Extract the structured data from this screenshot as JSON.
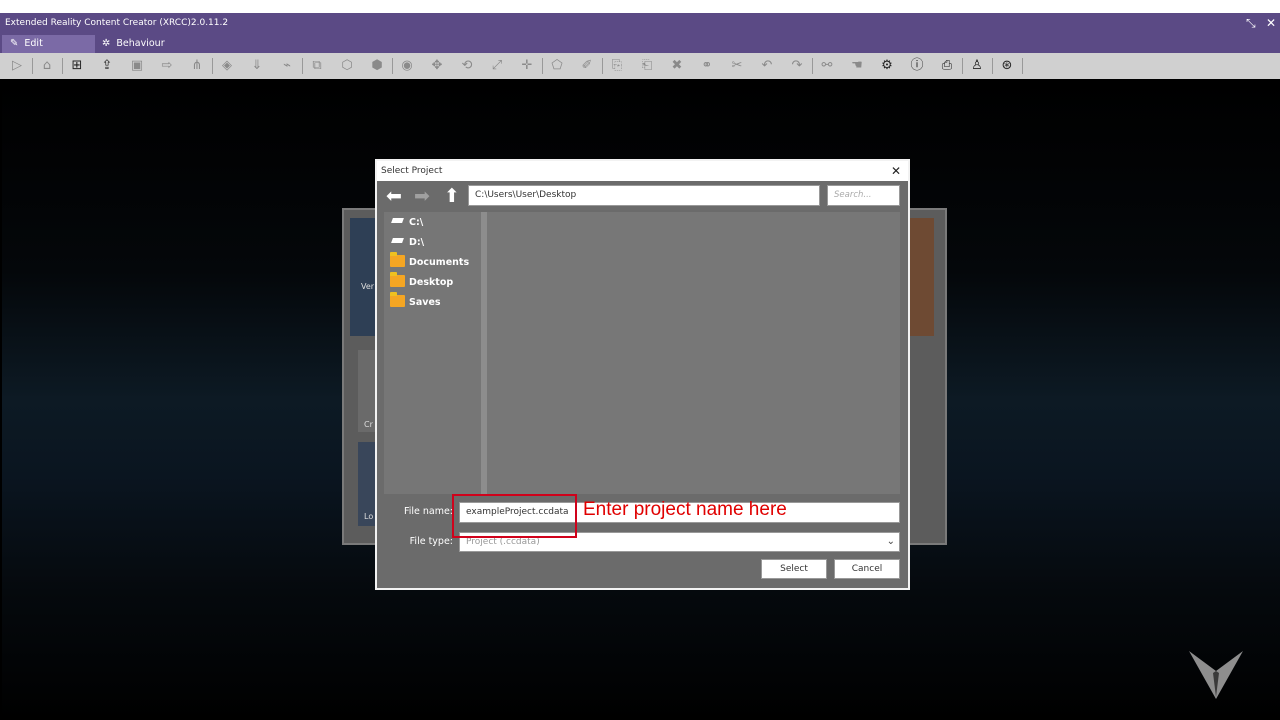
{
  "window": {
    "title": "Extended Reality Content Creator (XRCC)2.0.11.2",
    "restore_icon": "restore-icon",
    "close_icon": "close-icon"
  },
  "tabs": [
    {
      "label": "Edit",
      "icon": "edit-icon",
      "active": true
    },
    {
      "label": "Behaviour",
      "icon": "gear-icon",
      "active": false
    }
  ],
  "background_card_text": [
    "Ver",
    "Cr",
    "Lo"
  ],
  "dialog": {
    "title": "Select Project",
    "path": "C:\\Users\\User\\Desktop",
    "search_placeholder": "Search...",
    "sidebar": [
      {
        "label": "C:\\",
        "icon": "drive-icon"
      },
      {
        "label": "D:\\",
        "icon": "drive-icon"
      },
      {
        "label": "Documents",
        "icon": "folder-icon"
      },
      {
        "label": "Desktop",
        "icon": "folder-icon"
      },
      {
        "label": "Saves",
        "icon": "folder-icon"
      }
    ],
    "file_name_label": "File name:",
    "file_name_value": "exampleProject.ccdata",
    "file_type_label": "File type:",
    "file_type_value": "Project (.ccdata)",
    "select_label": "Select",
    "cancel_label": "Cancel"
  },
  "annotation": {
    "text": "Enter project name here",
    "color": "#e00000"
  },
  "colors": {
    "titlebar": "#5b4a85",
    "toolbar": "#d0d0d0",
    "dialog_body": "#6b6b6b"
  }
}
